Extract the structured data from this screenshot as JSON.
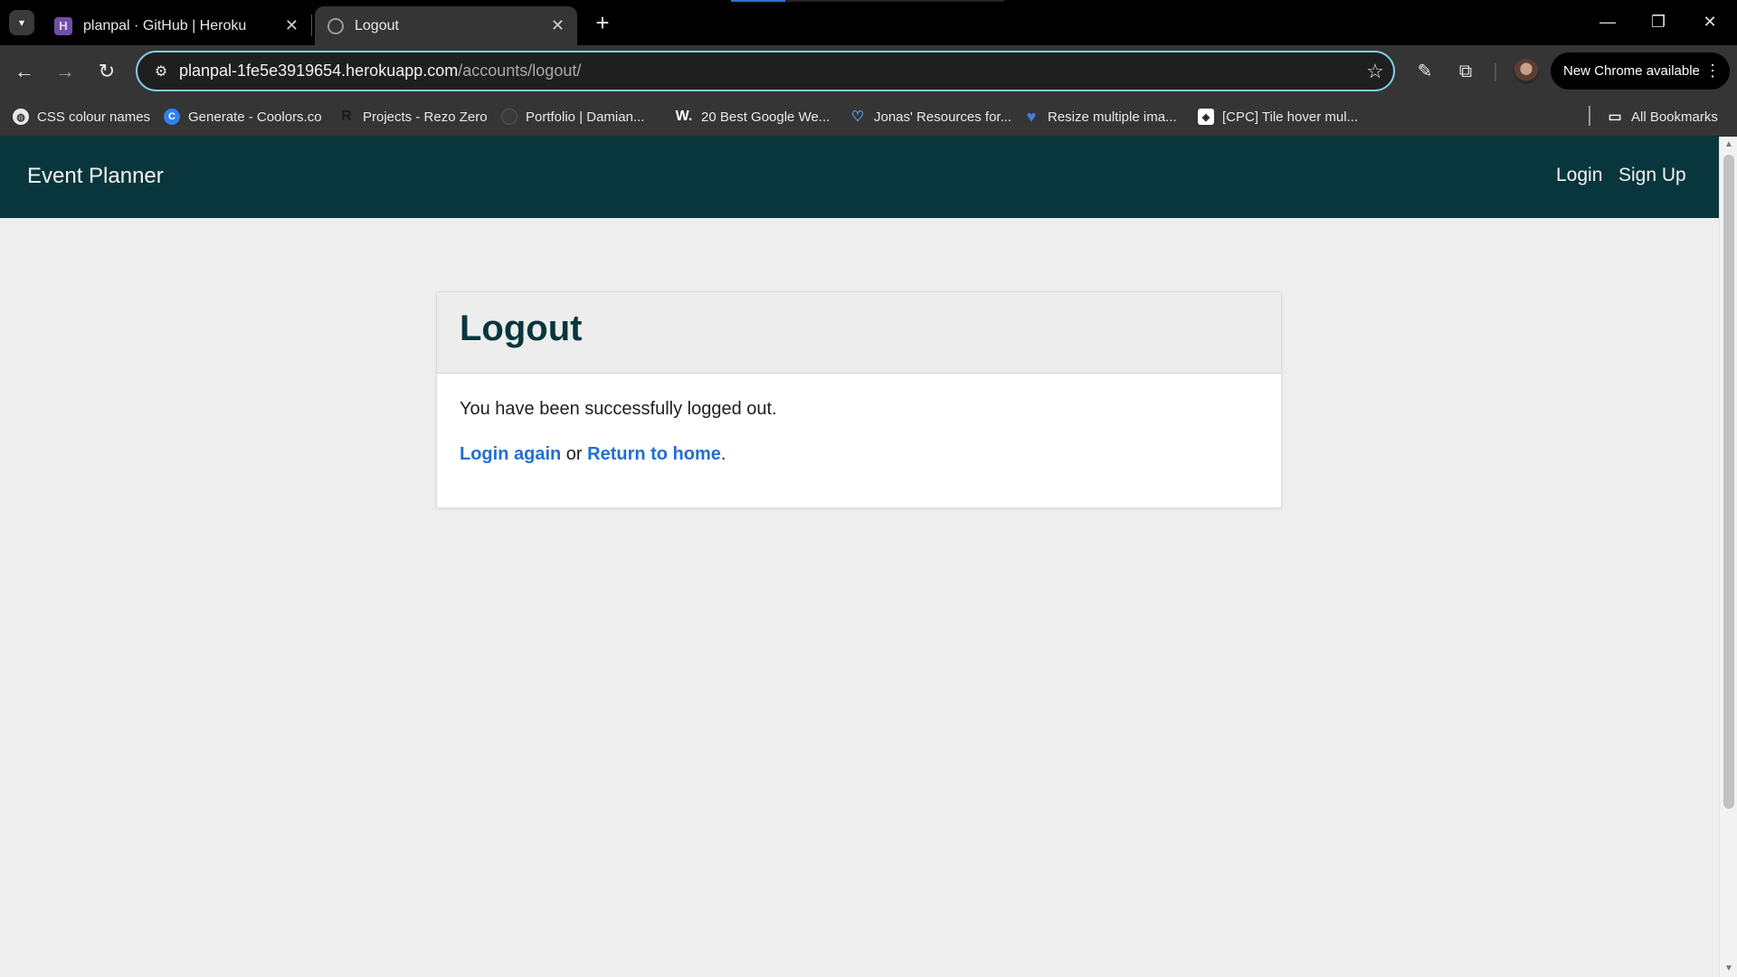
{
  "browser": {
    "tabs": [
      {
        "title": "planpal · GitHub | Heroku",
        "favicon": "heroku-icon",
        "active": false
      },
      {
        "title": "Logout",
        "favicon": "globe-icon",
        "active": true
      }
    ],
    "url_host": "planpal-1fe5e3919654.herokuapp.com",
    "url_path": "/accounts/logout/",
    "update_chip": "New Chrome available",
    "bookmarks": [
      {
        "label": "CSS colour names",
        "icon": "globe-icon"
      },
      {
        "label": "Generate - Coolors.co",
        "icon": "coolors-icon"
      },
      {
        "label": "Projects - Rezo Zero",
        "icon": "rezo-icon"
      },
      {
        "label": "Portfolio | Damian...",
        "icon": "portfolio-icon"
      },
      {
        "label": "20 Best Google We...",
        "icon": "w-icon"
      },
      {
        "label": "Jonas' Resources for...",
        "icon": "heart-outline-icon"
      },
      {
        "label": "Resize multiple ima...",
        "icon": "heart-icon"
      },
      {
        "label": "[CPC] Tile hover mul...",
        "icon": "codepen-icon"
      }
    ],
    "all_bookmarks": "All Bookmarks"
  },
  "site": {
    "brand": "Event Planner",
    "nav": {
      "login": "Login",
      "signup": "Sign Up"
    }
  },
  "card": {
    "title": "Logout",
    "message": "You have been successfully logged out.",
    "login_again": "Login again",
    "or": " or ",
    "return_home": "Return to home",
    "period": "."
  },
  "colors": {
    "navbar": "#09363d",
    "page_bg": "#efeeee",
    "link": "#1f6fd1",
    "omnibox_focus": "#7fcde8"
  }
}
